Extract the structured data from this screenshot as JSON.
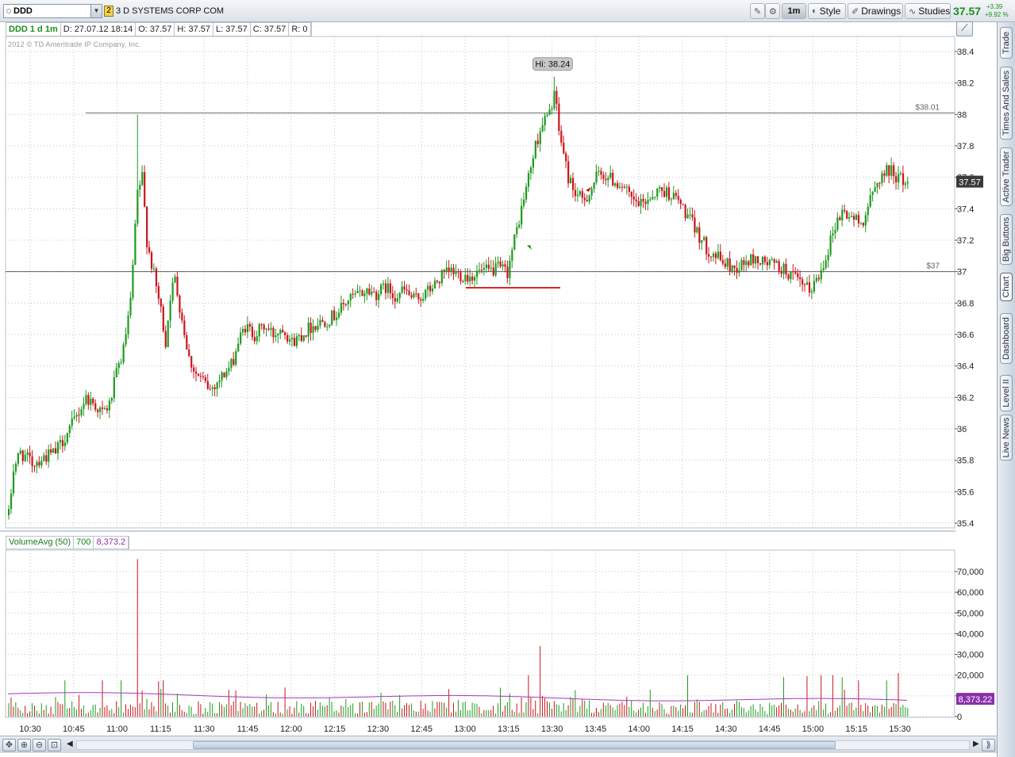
{
  "toolbar": {
    "symbol": "DDD",
    "link_badge": "2",
    "company": "3 D SYSTEMS CORP COM",
    "aggregation": "1m",
    "style_label": "Style",
    "drawings_label": "Drawings",
    "studies_label": "Studies",
    "last_price": "37.57",
    "change_abs": "+3.39",
    "change_pct": "+9.92 %"
  },
  "side_tabs": [
    "Trade",
    "Times And Sales",
    "Active Trader",
    "Big Buttons",
    "Chart",
    "Dashboard",
    "Level II",
    "Live News"
  ],
  "header": {
    "symbol_period": "DDD 1 d 1m",
    "date": "D: 27.07.12 18:14",
    "open": "O: 37.57",
    "high": "H: 37.57",
    "low": "L: 37.57",
    "close": "C: 37.57",
    "range": "R: 0",
    "copyright": "2012 © TD Ameritrade IP Company, Inc."
  },
  "study": {
    "name": "VolumeAvg (50)",
    "volume": "700",
    "avg": "8,373.2",
    "avg_label": "8,373.22"
  },
  "colors": {
    "up": "#1f9a1f",
    "down": "#c8151b",
    "avg_line": "#a43ab8",
    "price_tag_bg": "#3a3a3a",
    "avg_tag_bg": "#8a2fa8",
    "support_line": "#d9262c"
  },
  "chart_data": {
    "type": "candlestick",
    "price_axis": {
      "range": [
        35.35,
        38.5
      ],
      "ticks": [
        35.4,
        35.6,
        35.8,
        36,
        36.2,
        36.4,
        36.6,
        36.8,
        37,
        37.2,
        37.4,
        37.6,
        37.8,
        38,
        38.2,
        38.4
      ],
      "tick_labels": [
        "35.4",
        "35.6",
        "35.8",
        "36",
        "36.2",
        "36.4",
        "36.6",
        "36.8",
        "37",
        "37.2",
        "37.4",
        "37.6",
        "37.8",
        "38",
        "38.2",
        "38.4"
      ]
    },
    "volume_axis": {
      "range": [
        0,
        78000
      ],
      "ticks": [
        0,
        10000,
        20000,
        30000,
        40000,
        50000,
        60000,
        70000
      ],
      "tick_labels": [
        "0",
        "",
        "20,000",
        "30,000",
        "40,000",
        "50,000",
        "60,000",
        "70,000"
      ]
    },
    "time_axis": {
      "ticks": [
        "10:30",
        "10:45",
        "11:00",
        "11:15",
        "11:30",
        "11:45",
        "12:00",
        "12:15",
        "12:30",
        "12:45",
        "13:00",
        "13:15",
        "13:30",
        "13:45",
        "14:00",
        "14:15",
        "14:30",
        "14:45",
        "15:00",
        "15:15",
        "15:30"
      ]
    },
    "annotations": {
      "high_label": "Hi: 38.24",
      "high_value": 38.24,
      "level_1_label": "$38.01",
      "level_1_value": 38.01,
      "level_2_label": "$37",
      "level_2_value": 37.0,
      "last_price_label": "37.57",
      "last_price_value": 37.57,
      "volume_avg_value": 8373.22
    },
    "price_path": [
      [
        0,
        35.45
      ],
      [
        2,
        35.75
      ],
      [
        5,
        35.85
      ],
      [
        10,
        35.78
      ],
      [
        15,
        35.82
      ],
      [
        20,
        35.85
      ],
      [
        24,
        35.95
      ],
      [
        28,
        36.05
      ],
      [
        33,
        36.2
      ],
      [
        37,
        36.15
      ],
      [
        40,
        36.1
      ],
      [
        43,
        36.15
      ],
      [
        46,
        36.35
      ],
      [
        49,
        36.5
      ],
      [
        52,
        36.8
      ],
      [
        55,
        37.5
      ],
      [
        57,
        37.6
      ],
      [
        59,
        37.2
      ],
      [
        61,
        37.05
      ],
      [
        63,
        36.9
      ],
      [
        65,
        36.75
      ],
      [
        67,
        36.55
      ],
      [
        69,
        36.85
      ],
      [
        71,
        36.95
      ],
      [
        74,
        36.7
      ],
      [
        77,
        36.45
      ],
      [
        80,
        36.35
      ],
      [
        83,
        36.3
      ],
      [
        86,
        36.25
      ],
      [
        89,
        36.3
      ],
      [
        92,
        36.35
      ],
      [
        95,
        36.4
      ],
      [
        98,
        36.55
      ],
      [
        101,
        36.65
      ],
      [
        105,
        36.6
      ],
      [
        109,
        36.65
      ],
      [
        113,
        36.6
      ],
      [
        117,
        36.65
      ],
      [
        121,
        36.55
      ],
      [
        125,
        36.6
      ],
      [
        129,
        36.65
      ],
      [
        133,
        36.68
      ],
      [
        137,
        36.7
      ],
      [
        141,
        36.75
      ],
      [
        145,
        36.82
      ],
      [
        149,
        36.85
      ],
      [
        153,
        36.88
      ],
      [
        157,
        36.86
      ],
      [
        161,
        36.9
      ],
      [
        165,
        36.85
      ],
      [
        169,
        36.88
      ],
      [
        173,
        36.82
      ],
      [
        177,
        36.85
      ],
      [
        181,
        36.9
      ],
      [
        185,
        36.97
      ],
      [
        189,
        37.0
      ],
      [
        193,
        36.98
      ],
      [
        197,
        36.97
      ],
      [
        201,
        37.0
      ],
      [
        205,
        37.0
      ],
      [
        209,
        37.02
      ],
      [
        213,
        37.0
      ],
      [
        216,
        37.2
      ],
      [
        219,
        37.4
      ],
      [
        222,
        37.6
      ],
      [
        225,
        37.8
      ],
      [
        228,
        37.95
      ],
      [
        231,
        38.0
      ],
      [
        233,
        38.15
      ],
      [
        235,
        37.9
      ],
      [
        237,
        37.75
      ],
      [
        239,
        37.6
      ],
      [
        242,
        37.5
      ],
      [
        245,
        37.45
      ],
      [
        248,
        37.5
      ],
      [
        251,
        37.6
      ],
      [
        254,
        37.62
      ],
      [
        258,
        37.58
      ],
      [
        262,
        37.55
      ],
      [
        266,
        37.45
      ],
      [
        270,
        37.42
      ],
      [
        274,
        37.48
      ],
      [
        278,
        37.52
      ],
      [
        282,
        37.5
      ],
      [
        286,
        37.45
      ],
      [
        290,
        37.35
      ],
      [
        294,
        37.25
      ],
      [
        298,
        37.15
      ],
      [
        302,
        37.1
      ],
      [
        306,
        37.05
      ],
      [
        310,
        37.02
      ],
      [
        314,
        37.05
      ],
      [
        318,
        37.08
      ],
      [
        322,
        37.06
      ],
      [
        326,
        37.05
      ],
      [
        330,
        37.02
      ],
      [
        334,
        36.98
      ],
      [
        338,
        36.92
      ],
      [
        342,
        36.88
      ],
      [
        346,
        36.97
      ],
      [
        350,
        37.15
      ],
      [
        353,
        37.3
      ],
      [
        356,
        37.38
      ],
      [
        360,
        37.35
      ],
      [
        364,
        37.3
      ],
      [
        368,
        37.45
      ],
      [
        372,
        37.6
      ],
      [
        376,
        37.65
      ],
      [
        380,
        37.6
      ],
      [
        383,
        37.57
      ]
    ],
    "volume_spikes": [
      [
        55,
        76000
      ],
      [
        227,
        34000
      ],
      [
        222,
        20000
      ],
      [
        290,
        20000
      ],
      [
        341,
        19500
      ],
      [
        347,
        20000
      ],
      [
        352,
        20000
      ],
      [
        356,
        19000
      ],
      [
        380,
        21000
      ],
      [
        363,
        17500
      ],
      [
        375,
        17500
      ],
      [
        331,
        19000
      ],
      [
        24,
        17500
      ],
      [
        40,
        17500
      ],
      [
        48,
        17500
      ],
      [
        64,
        17000
      ],
      [
        66,
        17500
      ],
      [
        118,
        14000
      ]
    ]
  }
}
